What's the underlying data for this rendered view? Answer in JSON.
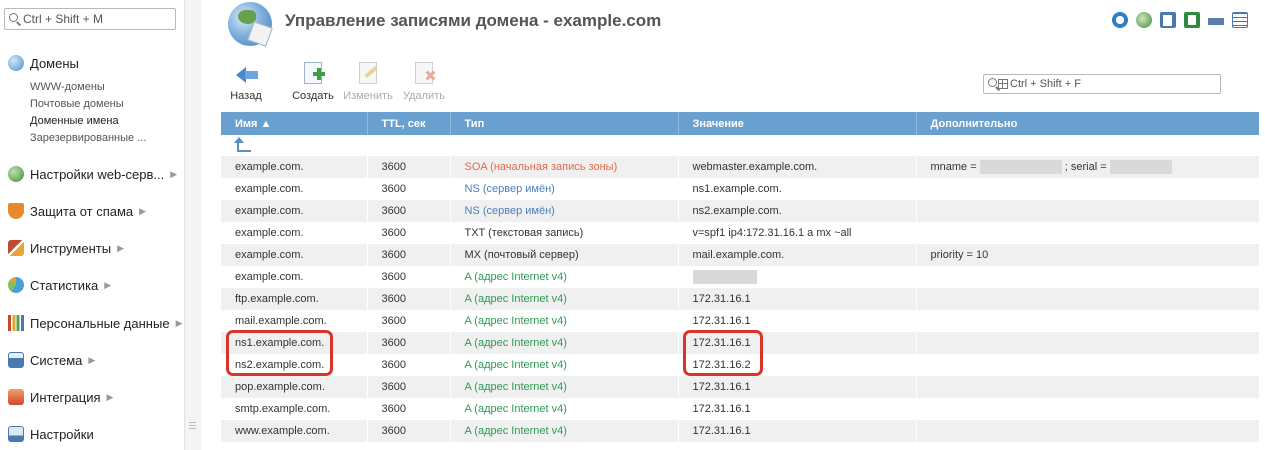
{
  "sidebar": {
    "search_placeholder": "Ctrl + Shift + M",
    "groups": [
      {
        "label": "Домены",
        "icon": "globe-icon",
        "color": "#5aa0d8"
      },
      {
        "label": "Настройки web-серв...",
        "icon": "web-settings-icon",
        "color": "#5a9c4a"
      },
      {
        "label": "Защита от спама",
        "icon": "spam-shield-icon",
        "color": "#e0862a"
      },
      {
        "label": "Инструменты",
        "icon": "tools-icon",
        "color": "#c24a2e"
      },
      {
        "label": "Статистика",
        "icon": "statistics-icon",
        "color": "#4aa0d0"
      },
      {
        "label": "Персональные данные",
        "icon": "personal-data-icon",
        "color": "#7a5aa8"
      },
      {
        "label": "Система",
        "icon": "system-icon",
        "color": "#4a78b0"
      },
      {
        "label": "Интеграция",
        "icon": "integration-icon",
        "color": "#d2462e"
      },
      {
        "label": "Настройки",
        "icon": "settings-icon",
        "color": "#4a7ab0"
      }
    ],
    "domain_items": [
      "WWW-домены",
      "Почтовые домены",
      "Доменные имена",
      "Зарезервированные ..."
    ],
    "active_item": "Доменные имена"
  },
  "header": {
    "title": "Управление записями домена - example.com",
    "icons": [
      "refresh-icon",
      "webmail-icon",
      "copy-icon",
      "excel-icon",
      "print-icon",
      "table-settings-icon"
    ]
  },
  "toolbar": {
    "back": "Назад",
    "create": "Создать",
    "edit": "Изменить",
    "delete": "Удалить",
    "search_placeholder": "Ctrl + Shift + F"
  },
  "table": {
    "headers": [
      "Имя ▲",
      "TTL, сек",
      "Тип",
      "Значение",
      "Дополнительно"
    ],
    "rows": [
      {
        "name": "example.com.",
        "ttl": "3600",
        "type": "SOA (начальная запись зоны)",
        "type_class": "soa",
        "value": "webmaster.example.com.",
        "extra": "mname = ",
        "extra2": " ; serial = ",
        "redacted": true
      },
      {
        "name": "example.com.",
        "ttl": "3600",
        "type": "NS (сервер имён)",
        "type_class": "ns",
        "value": "ns1.example.com.",
        "extra": ""
      },
      {
        "name": "example.com.",
        "ttl": "3600",
        "type": "NS (сервер имён)",
        "type_class": "ns",
        "value": "ns2.example.com.",
        "extra": ""
      },
      {
        "name": "example.com.",
        "ttl": "3600",
        "type": "TXT (текстовая запись)",
        "type_class": "plain",
        "value": "v=spf1 ip4:172.31.16.1 a mx ~all",
        "extra": ""
      },
      {
        "name": "example.com.",
        "ttl": "3600",
        "type": "MX (почтовый сервер)",
        "type_class": "plain",
        "value": "mail.example.com.",
        "extra": "priority = 10"
      },
      {
        "name": "example.com.",
        "ttl": "3600",
        "type": "A (адрес Internet v4)",
        "type_class": "a",
        "value": "",
        "value_redacted": true,
        "extra": ""
      },
      {
        "name": "ftp.example.com.",
        "ttl": "3600",
        "type": "A (адрес Internet v4)",
        "type_class": "a",
        "value": "172.31.16.1",
        "extra": ""
      },
      {
        "name": "mail.example.com.",
        "ttl": "3600",
        "type": "A (адрес Internet v4)",
        "type_class": "a",
        "value": "172.31.16.1",
        "extra": ""
      },
      {
        "name": "ns1.example.com.",
        "ttl": "3600",
        "type": "A (адрес Internet v4)",
        "type_class": "a",
        "value": "172.31.16.1",
        "extra": ""
      },
      {
        "name": "ns2.example.com.",
        "ttl": "3600",
        "type": "A (адрес Internet v4)",
        "type_class": "a",
        "value": "172.31.16.2",
        "extra": ""
      },
      {
        "name": "pop.example.com.",
        "ttl": "3600",
        "type": "A (адрес Internet v4)",
        "type_class": "a",
        "value": "172.31.16.1",
        "extra": ""
      },
      {
        "name": "smtp.example.com.",
        "ttl": "3600",
        "type": "A (адрес Internet v4)",
        "type_class": "a",
        "value": "172.31.16.1",
        "extra": ""
      },
      {
        "name": "www.example.com.",
        "ttl": "3600",
        "type": "A (адрес Internet v4)",
        "type_class": "a",
        "value": "172.31.16.1",
        "extra": ""
      }
    ]
  },
  "colors": {
    "header_bg": "#6aa0cf",
    "highlight": "#d9342b",
    "type_soa": "#e06a4c",
    "type_ns": "#4a7fbf",
    "type_a": "#2f9a55"
  }
}
